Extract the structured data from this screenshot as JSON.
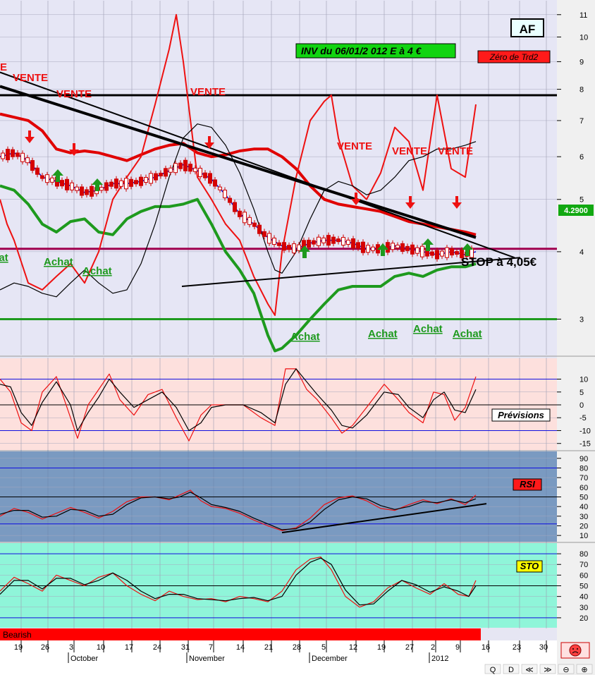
{
  "chart_data": [
    {
      "panel": "price",
      "type": "line",
      "title": "AF",
      "annotation_box": "INV du 06/01/2 012     E à  4 €",
      "legend_box": "Zéro de Trd2",
      "last_price_label": "4.2900",
      "y_scale": "log",
      "ylim": [
        2.6,
        11.5
      ],
      "yticks": [
        "3",
        "4",
        "5",
        "6",
        "7",
        "8",
        "9",
        "10",
        "11"
      ],
      "stop_note": "STOP à 4,05€",
      "horizontal_levels": [
        {
          "value": 7.8,
          "color": "#000000"
        },
        {
          "value": 4.05,
          "color": "#a0004e"
        },
        {
          "value": 3.0,
          "color": "#1f9a1f"
        }
      ],
      "series": [
        {
          "color": "#e00000",
          "x": [
            0,
            20,
            40,
            60,
            80,
            100,
            120,
            140,
            160,
            180,
            200,
            220,
            240,
            260,
            280,
            300,
            320,
            340,
            360,
            380,
            400,
            420,
            440,
            460,
            480,
            500,
            520,
            540,
            560,
            580,
            600,
            620,
            640,
            660,
            675
          ],
          "values": [
            7.2,
            7.1,
            7.0,
            6.7,
            6.2,
            6.1,
            6.15,
            6.1,
            6.0,
            5.9,
            6.05,
            6.2,
            6.3,
            6.35,
            6.1,
            6.0,
            6.05,
            6.15,
            6.2,
            6.2,
            6.0,
            5.7,
            5.3,
            5.0,
            4.9,
            4.85,
            4.8,
            4.75,
            4.65,
            4.55,
            4.5,
            4.45,
            4.4,
            4.35,
            4.3
          ]
        },
        {
          "color": "#1010d0",
          "x": [
            0,
            20,
            40,
            60,
            80,
            100,
            120,
            140,
            160,
            180,
            200,
            220,
            240,
            260,
            280,
            300,
            320,
            340,
            360,
            380,
            400,
            420,
            440,
            460,
            480,
            500,
            520,
            540,
            560,
            580,
            600,
            620,
            640,
            660,
            675
          ],
          "values": [
            6.0,
            6.1,
            5.9,
            5.5,
            5.4,
            5.3,
            5.15,
            5.2,
            5.35,
            5.35,
            5.4,
            5.5,
            5.65,
            5.8,
            5.65,
            5.45,
            5.1,
            4.7,
            4.5,
            4.25,
            4.1,
            4.05,
            4.15,
            4.2,
            4.2,
            4.15,
            4.05,
            4.05,
            4.1,
            4.05,
            4.0,
            3.95,
            4.0,
            3.95,
            4.0
          ]
        },
        {
          "color": "#1e9a1e",
          "x": [
            0,
            20,
            40,
            60,
            80,
            100,
            120,
            140,
            160,
            180,
            200,
            220,
            240,
            260,
            280,
            300,
            320,
            340,
            360,
            380,
            390,
            400,
            420,
            440,
            460,
            480,
            500,
            520,
            540,
            560,
            580,
            600,
            620,
            640,
            660,
            675
          ],
          "values": [
            5.3,
            5.2,
            4.9,
            4.5,
            4.35,
            4.55,
            4.6,
            4.35,
            4.3,
            4.6,
            4.75,
            4.85,
            4.85,
            4.9,
            5.0,
            4.5,
            4.0,
            3.7,
            3.35,
            2.8,
            2.62,
            2.65,
            2.8,
            3.0,
            3.2,
            3.4,
            3.45,
            3.45,
            3.45,
            3.6,
            3.65,
            3.6,
            3.7,
            3.75,
            3.75,
            3.8
          ]
        },
        {
          "color": "#ee1111",
          "x": [
            0,
            10,
            20,
            40,
            60,
            80,
            100,
            120,
            140,
            160,
            180,
            200,
            220,
            240,
            250,
            260,
            280,
            300,
            320,
            340,
            360,
            380,
            390,
            400,
            420,
            440,
            460,
            470,
            480,
            500,
            520,
            540,
            560,
            580,
            600,
            620,
            640,
            660,
            675
          ],
          "values": [
            5.0,
            4.5,
            4.2,
            3.5,
            3.4,
            3.6,
            3.8,
            3.5,
            4.0,
            5.0,
            5.5,
            6.0,
            7.5,
            9.5,
            11.0,
            9.0,
            5.5,
            5.0,
            4.5,
            4.2,
            3.6,
            3.2,
            3.05,
            4.0,
            5.5,
            7.0,
            7.6,
            7.8,
            6.5,
            5.3,
            5.0,
            5.6,
            6.8,
            6.4,
            5.2,
            7.8,
            5.7,
            5.5,
            7.5
          ]
        },
        {
          "color": "#000000",
          "x": [
            0,
            20,
            40,
            60,
            80,
            100,
            120,
            140,
            160,
            180,
            200,
            220,
            240,
            260,
            280,
            300,
            320,
            340,
            360,
            380,
            390,
            400,
            420,
            440,
            460,
            480,
            500,
            520,
            540,
            560,
            580,
            600,
            620,
            640,
            660,
            675
          ],
          "values": [
            3.4,
            3.5,
            3.45,
            3.35,
            3.3,
            3.5,
            3.7,
            3.5,
            3.35,
            3.4,
            3.8,
            4.5,
            5.5,
            6.5,
            6.9,
            6.8,
            6.3,
            5.6,
            4.8,
            4.0,
            3.7,
            3.65,
            4.0,
            4.6,
            5.2,
            5.4,
            5.3,
            5.1,
            5.2,
            5.5,
            5.9,
            6.0,
            6.2,
            6.2,
            6.3,
            6.4
          ]
        },
        {
          "color": "#000000",
          "label": "trendline",
          "x": [
            0,
            675
          ],
          "values": [
            8.1,
            4.25
          ]
        },
        {
          "color": "#000000",
          "label": "trendline",
          "x": [
            0,
            730
          ],
          "values": [
            8.6,
            3.9
          ]
        },
        {
          "color": "#000000",
          "label": "trendline",
          "x": [
            258,
            738
          ],
          "values": [
            3.45,
            3.9
          ]
        }
      ],
      "signals": [
        {
          "text": "VENTE",
          "color": "#ee1111"
        },
        {
          "text": "VENTE",
          "color": "#ee1111"
        },
        {
          "text": "VENTE",
          "color": "#ee1111"
        },
        {
          "text": "VENTE",
          "color": "#ee1111"
        },
        {
          "text": "VENTE",
          "color": "#ee1111"
        },
        {
          "text": "VENTE",
          "color": "#ee1111"
        },
        {
          "text": "Achat",
          "color": "#1e9a1e"
        },
        {
          "text": "Achat",
          "color": "#1e9a1e"
        },
        {
          "text": "Achat",
          "color": "#1e9a1e"
        },
        {
          "text": "Achat",
          "color": "#1e9a1e"
        },
        {
          "text": "Achat",
          "color": "#1e9a1e"
        },
        {
          "text": "Achat",
          "color": "#1e9a1e"
        },
        {
          "text": "Achat",
          "color": "#1e9a1e"
        }
      ]
    },
    {
      "panel": "forecast",
      "type": "line",
      "label_box": "Prévisions",
      "ylim": [
        -17,
        17
      ],
      "yticks": [
        "10",
        "5",
        "0",
        "-5",
        "-10",
        "-15"
      ],
      "levels": [
        10,
        0,
        -10
      ],
      "series": [
        {
          "color": "#ee1111",
          "x": [
            0,
            15,
            30,
            45,
            60,
            80,
            100,
            110,
            125,
            140,
            155,
            170,
            190,
            210,
            230,
            250,
            268,
            285,
            300,
            320,
            345,
            370,
            390,
            405,
            420,
            435,
            450,
            470,
            485,
            500,
            520,
            545,
            565,
            580,
            600,
            615,
            630,
            645,
            660,
            675
          ],
          "values": [
            10,
            5,
            -7,
            -10,
            5,
            11,
            -5,
            -13,
            0,
            6,
            12,
            2,
            -4,
            4,
            6,
            -5,
            -14,
            -4,
            0,
            0,
            0,
            -5,
            -8,
            14,
            14,
            6,
            2,
            -5,
            -11,
            -8,
            -1,
            8,
            2,
            -3,
            -7,
            5,
            4,
            -6,
            -1,
            11
          ]
        },
        {
          "color": "#000000",
          "x": [
            0,
            15,
            30,
            45,
            60,
            80,
            100,
            110,
            125,
            140,
            155,
            170,
            190,
            210,
            230,
            250,
            268,
            285,
            300,
            320,
            345,
            370,
            390,
            405,
            420,
            435,
            450,
            470,
            485,
            500,
            520,
            545,
            565,
            580,
            600,
            615,
            630,
            645,
            660,
            675
          ],
          "values": [
            8,
            7,
            -3,
            -8,
            1,
            9,
            0,
            -10,
            -3,
            3,
            10,
            5,
            -1,
            2,
            5,
            -1,
            -10,
            -7,
            -1,
            0,
            0,
            -3,
            -7,
            8,
            14,
            9,
            4,
            -2,
            -8,
            -9,
            -4,
            5,
            4,
            -1,
            -5,
            2,
            5,
            -2,
            -3,
            6
          ]
        }
      ]
    },
    {
      "panel": "rsi",
      "type": "line",
      "label_box": "RSI",
      "ylim": [
        5,
        95
      ],
      "yticks": [
        "90",
        "80",
        "70",
        "60",
        "50",
        "40",
        "30",
        "20",
        "10"
      ],
      "levels": [
        80,
        50,
        22
      ],
      "series": [
        {
          "color": "#ee1111",
          "x": [
            0,
            20,
            40,
            60,
            80,
            100,
            120,
            140,
            160,
            180,
            200,
            220,
            240,
            255,
            270,
            285,
            300,
            320,
            340,
            360,
            380,
            400,
            420,
            440,
            460,
            480,
            500,
            520,
            540,
            560,
            580,
            600,
            620,
            640,
            660,
            675
          ],
          "values": [
            30,
            38,
            34,
            27,
            33,
            39,
            34,
            28,
            35,
            45,
            50,
            50,
            47,
            52,
            57,
            46,
            40,
            38,
            33,
            26,
            20,
            15,
            18,
            28,
            42,
            49,
            51,
            46,
            38,
            36,
            42,
            47,
            43,
            48,
            42,
            52
          ]
        },
        {
          "color": "#000000",
          "x": [
            0,
            20,
            40,
            60,
            80,
            100,
            120,
            140,
            160,
            180,
            200,
            220,
            240,
            255,
            270,
            285,
            300,
            320,
            340,
            360,
            380,
            400,
            420,
            440,
            460,
            480,
            500,
            520,
            540,
            560,
            580,
            600,
            620,
            640,
            660,
            675
          ],
          "values": [
            32,
            36,
            36,
            29,
            30,
            37,
            36,
            30,
            32,
            42,
            49,
            50,
            48,
            50,
            55,
            49,
            42,
            39,
            35,
            28,
            22,
            16,
            17,
            24,
            37,
            47,
            50,
            48,
            41,
            37,
            40,
            45,
            44,
            47,
            44,
            48
          ]
        },
        {
          "color": "#000000",
          "label": "trendline",
          "x": [
            400,
            690
          ],
          "values": [
            13,
            43
          ]
        }
      ]
    },
    {
      "panel": "sto",
      "type": "line",
      "label_box": "STO",
      "ylim": [
        12,
        88
      ],
      "yticks": [
        "80",
        "70",
        "60",
        "50",
        "40",
        "30",
        "20"
      ],
      "levels": [
        80,
        50,
        20
      ],
      "series": [
        {
          "color": "#ee1111",
          "x": [
            0,
            20,
            40,
            60,
            80,
            100,
            120,
            140,
            160,
            180,
            200,
            220,
            240,
            260,
            280,
            300,
            320,
            340,
            360,
            380,
            400,
            420,
            440,
            455,
            470,
            490,
            510,
            530,
            550,
            570,
            590,
            610,
            630,
            650,
            665,
            675
          ],
          "values": [
            45,
            58,
            52,
            45,
            60,
            55,
            50,
            58,
            62,
            50,
            42,
            36,
            45,
            40,
            37,
            38,
            35,
            40,
            38,
            35,
            45,
            65,
            75,
            77,
            65,
            40,
            30,
            35,
            48,
            55,
            48,
            42,
            52,
            42,
            40,
            55
          ]
        },
        {
          "color": "#000000",
          "x": [
            0,
            20,
            40,
            60,
            80,
            100,
            120,
            140,
            160,
            180,
            200,
            220,
            240,
            260,
            280,
            300,
            320,
            340,
            360,
            380,
            400,
            420,
            440,
            455,
            470,
            490,
            510,
            530,
            550,
            570,
            590,
            610,
            630,
            650,
            665,
            675
          ],
          "values": [
            42,
            55,
            55,
            47,
            57,
            57,
            51,
            55,
            62,
            55,
            45,
            38,
            42,
            42,
            38,
            37,
            36,
            38,
            39,
            36,
            40,
            60,
            72,
            76,
            70,
            46,
            32,
            33,
            45,
            55,
            51,
            44,
            49,
            45,
            40,
            50
          ]
        }
      ]
    }
  ],
  "status_bar": {
    "label": "Bearish",
    "color": "#ff0000"
  },
  "x_axis": {
    "day_ticks": [
      "19",
      "26",
      "3",
      "10",
      "17",
      "24",
      "31",
      "7",
      "14",
      "21",
      "28",
      "5",
      "12",
      "19",
      "27",
      "2",
      "9",
      "16",
      "23",
      "30"
    ],
    "month_labels": [
      "October",
      "November",
      "December",
      "2012"
    ]
  },
  "toolbar": {
    "buttons": [
      "Q",
      "D",
      "≪",
      "≫",
      "⊖",
      "⊕"
    ],
    "mood_icon": "sad-face-icon"
  }
}
